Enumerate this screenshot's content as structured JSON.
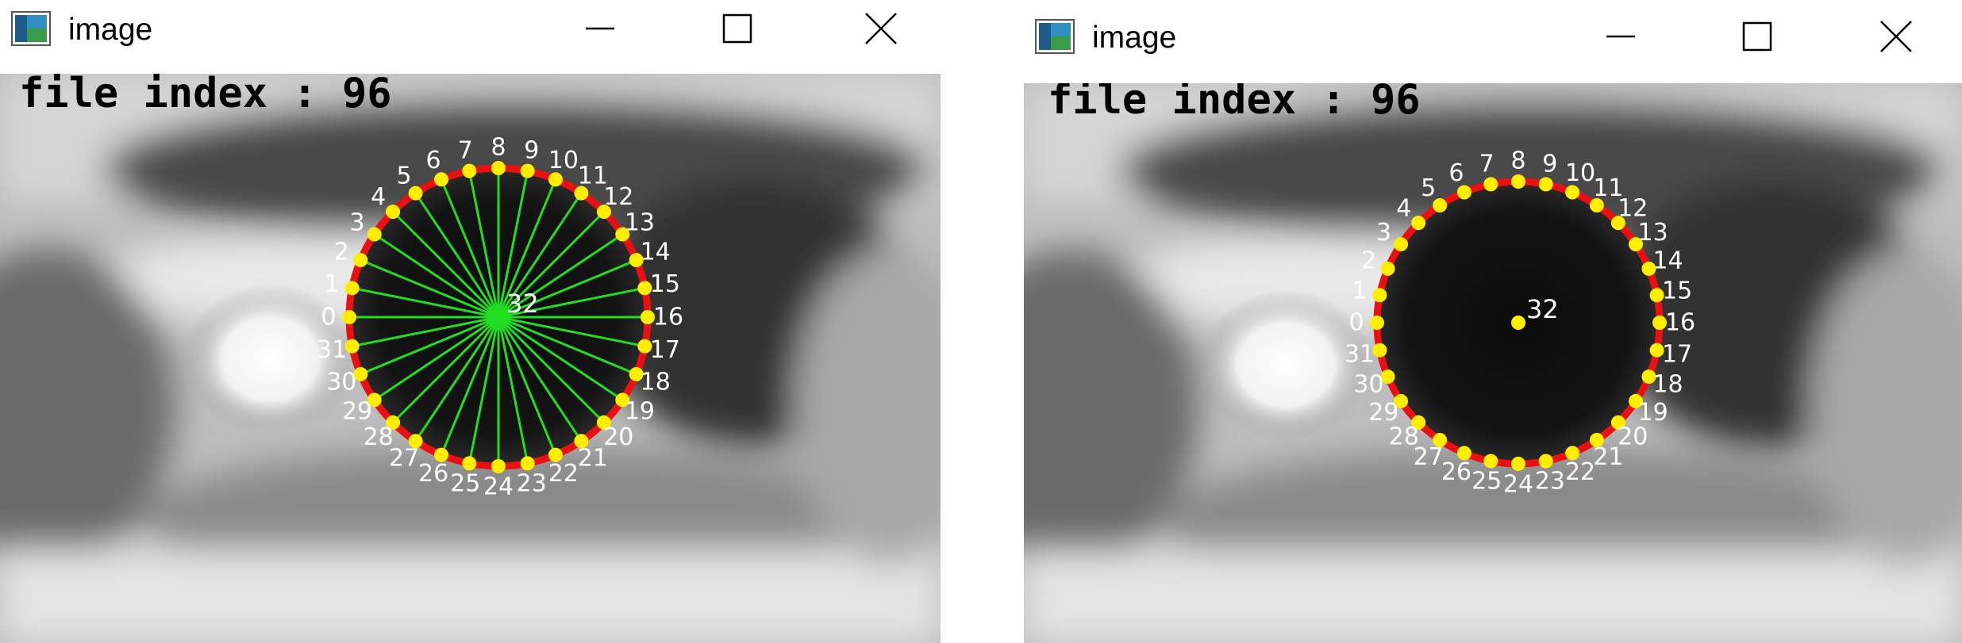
{
  "windows": [
    {
      "title": "image",
      "icon": "image-window-icon",
      "overlay_text": "file index : 96",
      "controls": [
        "minimize-icon",
        "maximize-icon",
        "close-icon"
      ],
      "show_radial_lines": true,
      "point_labels": [
        "0",
        "1",
        "2",
        "3",
        "4",
        "5",
        "6",
        "7",
        "8",
        "9",
        "10",
        "11",
        "12",
        "13",
        "14",
        "15",
        "16",
        "17",
        "18",
        "19",
        "20",
        "21",
        "22",
        "23",
        "24",
        "25",
        "26",
        "27",
        "28",
        "29",
        "30",
        "31"
      ],
      "center_label": "32"
    },
    {
      "title": "image",
      "icon": "image-window-icon",
      "overlay_text": "file index : 96",
      "controls": [
        "minimize-icon",
        "maximize-icon",
        "close-icon"
      ],
      "show_radial_lines": false,
      "point_labels": [
        "0",
        "1",
        "2",
        "3",
        "4",
        "5",
        "6",
        "7",
        "8",
        "9",
        "10",
        "11",
        "12",
        "13",
        "14",
        "15",
        "16",
        "17",
        "18",
        "19",
        "20",
        "21",
        "22",
        "23",
        "24",
        "25",
        "26",
        "27",
        "28",
        "29",
        "30",
        "31"
      ],
      "center_label": "32"
    }
  ],
  "colors": {
    "contour": "#e81010",
    "points": "#ffee00",
    "radial_lines": "#22dd22",
    "labels": "#ffffff",
    "overlay_text": "#000000"
  }
}
